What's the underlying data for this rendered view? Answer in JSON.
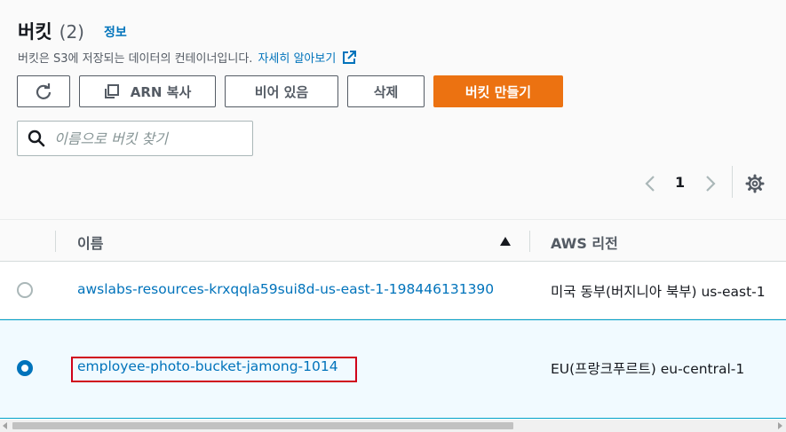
{
  "header": {
    "title": "버킷",
    "count": "(2)",
    "info_link": "정보",
    "description": "버킷은 S3에 저장되는 데이터의 컨테이너입니다.",
    "learn_more": "자세히 알아보기"
  },
  "toolbar": {
    "arn_copy_label": "ARN 복사",
    "empty_label": "비어 있음",
    "delete_label": "삭제",
    "create_label": "버킷 만들기"
  },
  "search": {
    "placeholder": "이름으로 버킷 찾기"
  },
  "pagination": {
    "current_page": "1"
  },
  "table": {
    "columns": [
      "이름",
      "AWS 리전"
    ],
    "sort_direction": "ascending",
    "rows": [
      {
        "name": "awslabs-resources-krxqqla59sui8d-us-east-1-198446131390",
        "region": "미국 동부(버지니아 북부) us-east-1",
        "selected": false
      },
      {
        "name": "employee-photo-bucket-jamong-1014",
        "region": "EU(프랑크푸르트) eu-central-1",
        "selected": true
      }
    ]
  },
  "colors": {
    "link": "#0073bb",
    "primary_button": "#ec7211",
    "selected_row_bg": "#f1faff",
    "selected_row_border": "#00a1c9",
    "highlight_annotation": "#d0021b"
  }
}
